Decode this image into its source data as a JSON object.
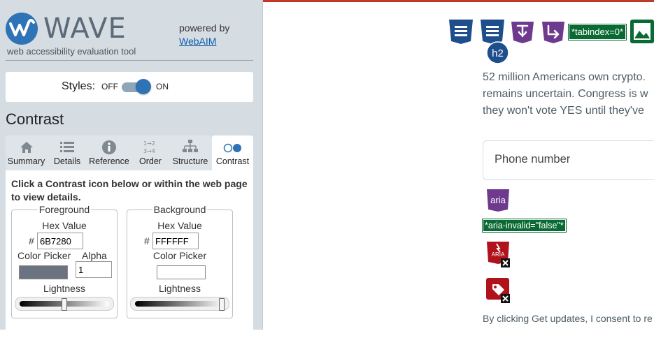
{
  "sidebar": {
    "app_name": "WAVE",
    "tagline": "web accessibility evaluation tool",
    "powered_by": "powered by",
    "webaim_link": "WebAIM",
    "styles_label": "Styles:",
    "toggle_off": "OFF",
    "toggle_on": "ON",
    "section_title": "Contrast",
    "tabs": [
      {
        "label": "Summary",
        "icon": "home-icon"
      },
      {
        "label": "Details",
        "icon": "list-icon"
      },
      {
        "label": "Reference",
        "icon": "info-icon"
      },
      {
        "label": "Order",
        "icon": "order-icon"
      },
      {
        "label": "Structure",
        "icon": "structure-icon"
      },
      {
        "label": "Contrast",
        "icon": "contrast-icon"
      }
    ],
    "active_tab": "Contrast",
    "instruction": "Click a Contrast icon below or within the web page to view details.",
    "foreground": {
      "legend": "Foreground",
      "hex_label": "Hex Value",
      "hash": "#",
      "hex_value": "6B7280",
      "picker_label": "Color Picker",
      "alpha_label": "Alpha",
      "alpha_value": "1",
      "lightness_label": "Lightness",
      "swatch_color": "#6B7280",
      "lightness_fraction": 0.5
    },
    "background": {
      "legend": "Background",
      "hex_label": "Hex Value",
      "hash": "#",
      "hex_value": "FFFFFF",
      "picker_label": "Color Picker",
      "lightness_label": "Lightness",
      "swatch_color": "#FFFFFF",
      "lightness_fraction": 0.97
    }
  },
  "main": {
    "badges": {
      "tabindex": "*tabindex=0*",
      "aria_invalid": "*aria-invalid=\"false\"*",
      "h2": "h2",
      "aria": "aria",
      "aria_broken": "ARIA"
    },
    "paragraph_lines": [
      "52 million Americans own crypto.",
      "remains uncertain. Congress is w",
      "they won't vote YES until they've"
    ],
    "phone_placeholder": "Phone number",
    "consent_text": "By clicking Get updates, I consent to re"
  },
  "colors": {
    "accent_blue": "#2e73b6",
    "wave_list_blue": "#1f4e8c",
    "aria_purple": "#6e3a8e",
    "error_red": "#b0121c",
    "badge_green": "#0a6a33"
  }
}
